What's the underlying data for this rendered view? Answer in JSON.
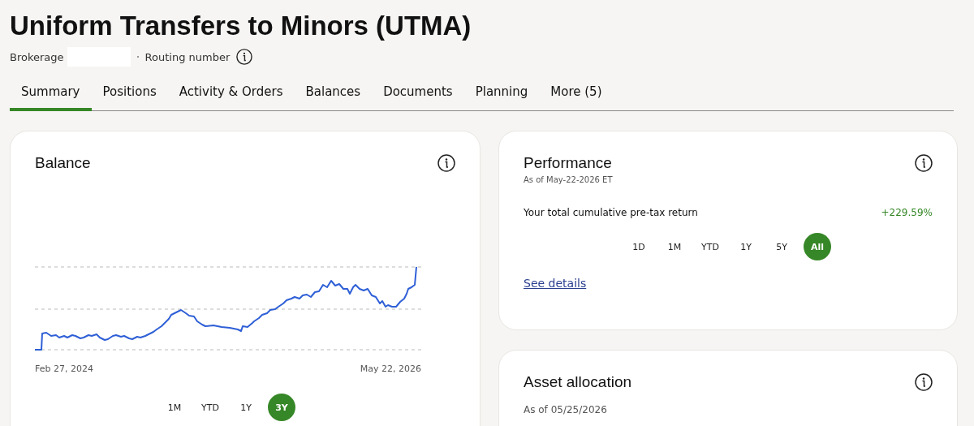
{
  "page": {
    "title": "Uniform Transfers to Minors (UTMA)",
    "account_type": "Brokerage",
    "routing_label": "Routing number"
  },
  "tabs": [
    {
      "label": "Summary",
      "selected": true
    },
    {
      "label": "Positions",
      "selected": false
    },
    {
      "label": "Activity & Orders",
      "selected": false
    },
    {
      "label": "Balances",
      "selected": false
    },
    {
      "label": "Documents",
      "selected": false
    },
    {
      "label": "Planning",
      "selected": false
    },
    {
      "label": "More (5)",
      "selected": false
    }
  ],
  "balance": {
    "title": "Balance",
    "start_date": "Feb 27, 2024",
    "end_date": "May 22, 2026",
    "ranges": [
      {
        "label": "1M",
        "selected": false
      },
      {
        "label": "YTD",
        "selected": false
      },
      {
        "label": "1Y",
        "selected": false
      },
      {
        "label": "3Y",
        "selected": true
      }
    ]
  },
  "performance": {
    "title": "Performance",
    "as_of": "As of May-22-2026 ET",
    "return_label": "Your total cumulative pre-tax return",
    "return_value": "+229.59%",
    "ranges": [
      {
        "label": "1D",
        "selected": false
      },
      {
        "label": "1M",
        "selected": false
      },
      {
        "label": "YTD",
        "selected": false
      },
      {
        "label": "1Y",
        "selected": false
      },
      {
        "label": "5Y",
        "selected": false
      },
      {
        "label": "All",
        "selected": true
      }
    ],
    "link": "See details"
  },
  "asset_allocation": {
    "title": "Asset allocation",
    "as_of": "As of 05/25/2026"
  }
}
